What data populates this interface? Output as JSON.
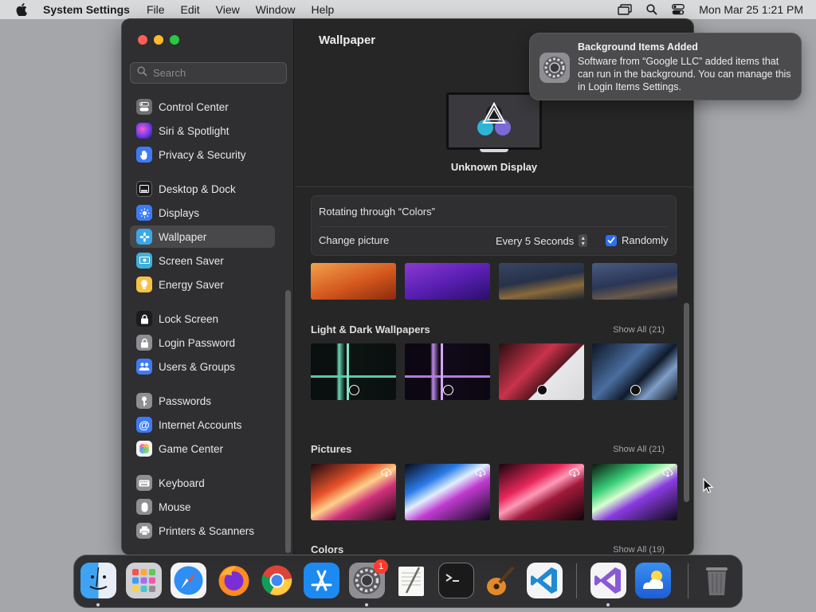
{
  "menubar": {
    "app_name": "System Settings",
    "menus": [
      "File",
      "Edit",
      "View",
      "Window",
      "Help"
    ],
    "clock": "Mon Mar 25  1:21 PM",
    "status_icons": [
      "screen-mirroring-icon",
      "search-icon",
      "control-center-icon"
    ]
  },
  "sidebar": {
    "search_placeholder": "Search",
    "items": [
      {
        "label": "Control Center",
        "icon": "control-center-icon",
        "color": "#6e6e73"
      },
      {
        "label": "Siri & Spotlight",
        "icon": "siri-icon",
        "color": "#c146d9"
      },
      {
        "label": "Privacy & Security",
        "icon": "hand-icon",
        "color": "#3d7bf6"
      },
      {
        "label": "Desktop & Dock",
        "icon": "dock-icon",
        "color": "#1c1c1e"
      },
      {
        "label": "Displays",
        "icon": "sun-icon",
        "color": "#3d7bf6"
      },
      {
        "label": "Wallpaper",
        "icon": "flower-icon",
        "color": "#39a7e9",
        "selected": true
      },
      {
        "label": "Screen Saver",
        "icon": "screen-saver-icon",
        "color": "#3fb1d8"
      },
      {
        "label": "Energy Saver",
        "icon": "lightbulb-icon",
        "color": "#f6c244"
      },
      {
        "label": "Lock Screen",
        "icon": "lock-icon",
        "color": "#1c1c1e"
      },
      {
        "label": "Login Password",
        "icon": "padlock-icon",
        "color": "#8e8e93"
      },
      {
        "label": "Users & Groups",
        "icon": "users-icon",
        "color": "#3d7bf6"
      },
      {
        "label": "Passwords",
        "icon": "key-icon",
        "color": "#8e8e93"
      },
      {
        "label": "Internet Accounts",
        "icon": "at-icon",
        "color": "#3d7bf6"
      },
      {
        "label": "Game Center",
        "icon": "game-center-icon",
        "color": "#f2f2f2"
      },
      {
        "label": "Keyboard",
        "icon": "keyboard-icon",
        "color": "#8e8e93"
      },
      {
        "label": "Mouse",
        "icon": "mouse-icon",
        "color": "#8e8e93"
      },
      {
        "label": "Printers & Scanners",
        "icon": "printer-icon",
        "color": "#8e8e93"
      }
    ]
  },
  "main": {
    "title": "Wallpaper",
    "display_label": "Unknown Display",
    "rotation": {
      "title": "Rotating through “Colors”",
      "change_label": "Change picture",
      "interval": "Every 5 Seconds",
      "random_label": "Randomly",
      "random_checked": true
    },
    "sections": [
      {
        "title": "Light & Dark Wallpapers",
        "show_all": "Show All (21)"
      },
      {
        "title": "Pictures",
        "show_all": "Show All (21)"
      },
      {
        "title": "Colors",
        "show_all": "Show All (19)"
      }
    ]
  },
  "notification": {
    "title": "Background Items Added",
    "body": "Software from “Google LLC” added items that can run in the background. You can manage this in Login Items Settings."
  },
  "dock": {
    "apps": [
      "Finder",
      "Launchpad",
      "Safari",
      "Firefox",
      "Chrome",
      "App Store",
      "System Settings",
      "TextEdit",
      "Terminal",
      "GarageBand",
      "Visual Studio Code",
      "Visual Studio",
      "Weather",
      "Trash"
    ],
    "system_settings_badge": "1"
  }
}
